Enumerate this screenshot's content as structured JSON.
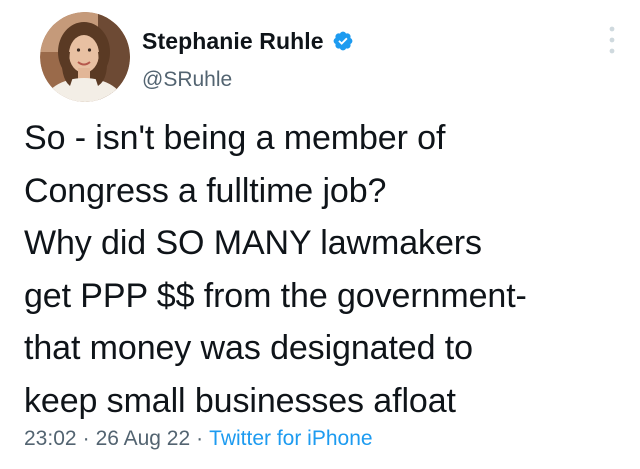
{
  "tweet": {
    "author": {
      "display_name": "Stephanie Ruhle",
      "handle": "@SRuhle",
      "verified": true,
      "avatar_icon": "profile-photo"
    },
    "text": "So - isn't being a member of\nCongress a fulltime job?\nWhy did SO MANY lawmakers\nget PPP $$ from the government-\nthat money was designated to\nkeep small businesses afloat",
    "time": "23:02",
    "separator": "·",
    "date": "26 Aug 22",
    "source": "Twitter for iPhone"
  },
  "colors": {
    "primary_text": "#0f1419",
    "secondary_text": "#536471",
    "accent": "#1d9bf0"
  },
  "icons": {
    "verified": "verified-badge-icon",
    "more": "more-options-icon"
  }
}
